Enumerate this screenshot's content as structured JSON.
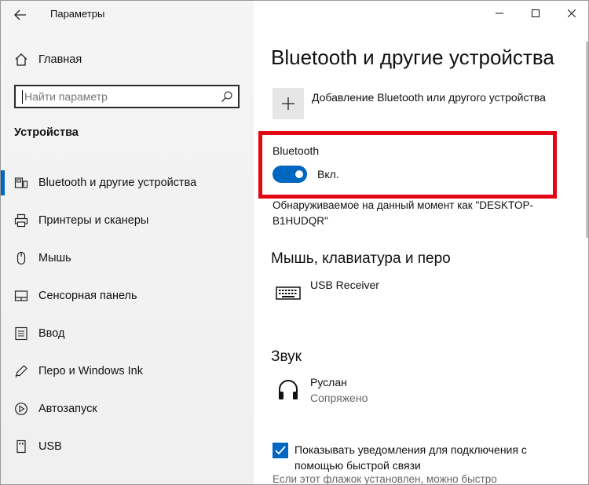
{
  "window": {
    "title": "Параметры"
  },
  "sidebar": {
    "home_label": "Главная",
    "search": {
      "placeholder": "Найти параметр"
    },
    "section_heading": "Устройства",
    "items": [
      {
        "label": "Bluetooth и другие устройства",
        "icon": "bluetooth-devices-icon",
        "active": true
      },
      {
        "label": "Принтеры и сканеры",
        "icon": "printer-icon",
        "active": false
      },
      {
        "label": "Мышь",
        "icon": "mouse-icon",
        "active": false
      },
      {
        "label": "Сенсорная панель",
        "icon": "touchpad-icon",
        "active": false
      },
      {
        "label": "Ввод",
        "icon": "keyboard-icon",
        "active": false
      },
      {
        "label": "Перо и Windows Ink",
        "icon": "pen-icon",
        "active": false
      },
      {
        "label": "Автозапуск",
        "icon": "autoplay-icon",
        "active": false
      },
      {
        "label": "USB",
        "icon": "usb-icon",
        "active": false
      }
    ]
  },
  "main": {
    "title": "Bluetooth и другие устройства",
    "add_device_label": "Добавление Bluetooth или другого устройства",
    "bluetooth": {
      "label": "Bluetooth",
      "state": "Вкл.",
      "on": true,
      "discoverable": "Обнаруживаемое на данный момент как \"DESKTOP-B1HUDQR\""
    },
    "mouse_section": {
      "heading": "Мышь, клавиатура и перо",
      "devices": [
        {
          "name": "USB Receiver",
          "icon": "keyboard-device-icon"
        }
      ]
    },
    "sound_section": {
      "heading": "Звук",
      "devices": [
        {
          "name": "Руслан",
          "status": "Сопряжено",
          "icon": "headphones-icon"
        }
      ]
    },
    "swift_pair": {
      "label": "Показывать уведомления для подключения с помощью быстрой связи",
      "checked": true,
      "hint": "Если этот флажок установлен, можно быстро"
    }
  },
  "colors": {
    "accent": "#0067c0",
    "highlight": "#e30613",
    "sidebar_bg": "#f2f2f2"
  }
}
